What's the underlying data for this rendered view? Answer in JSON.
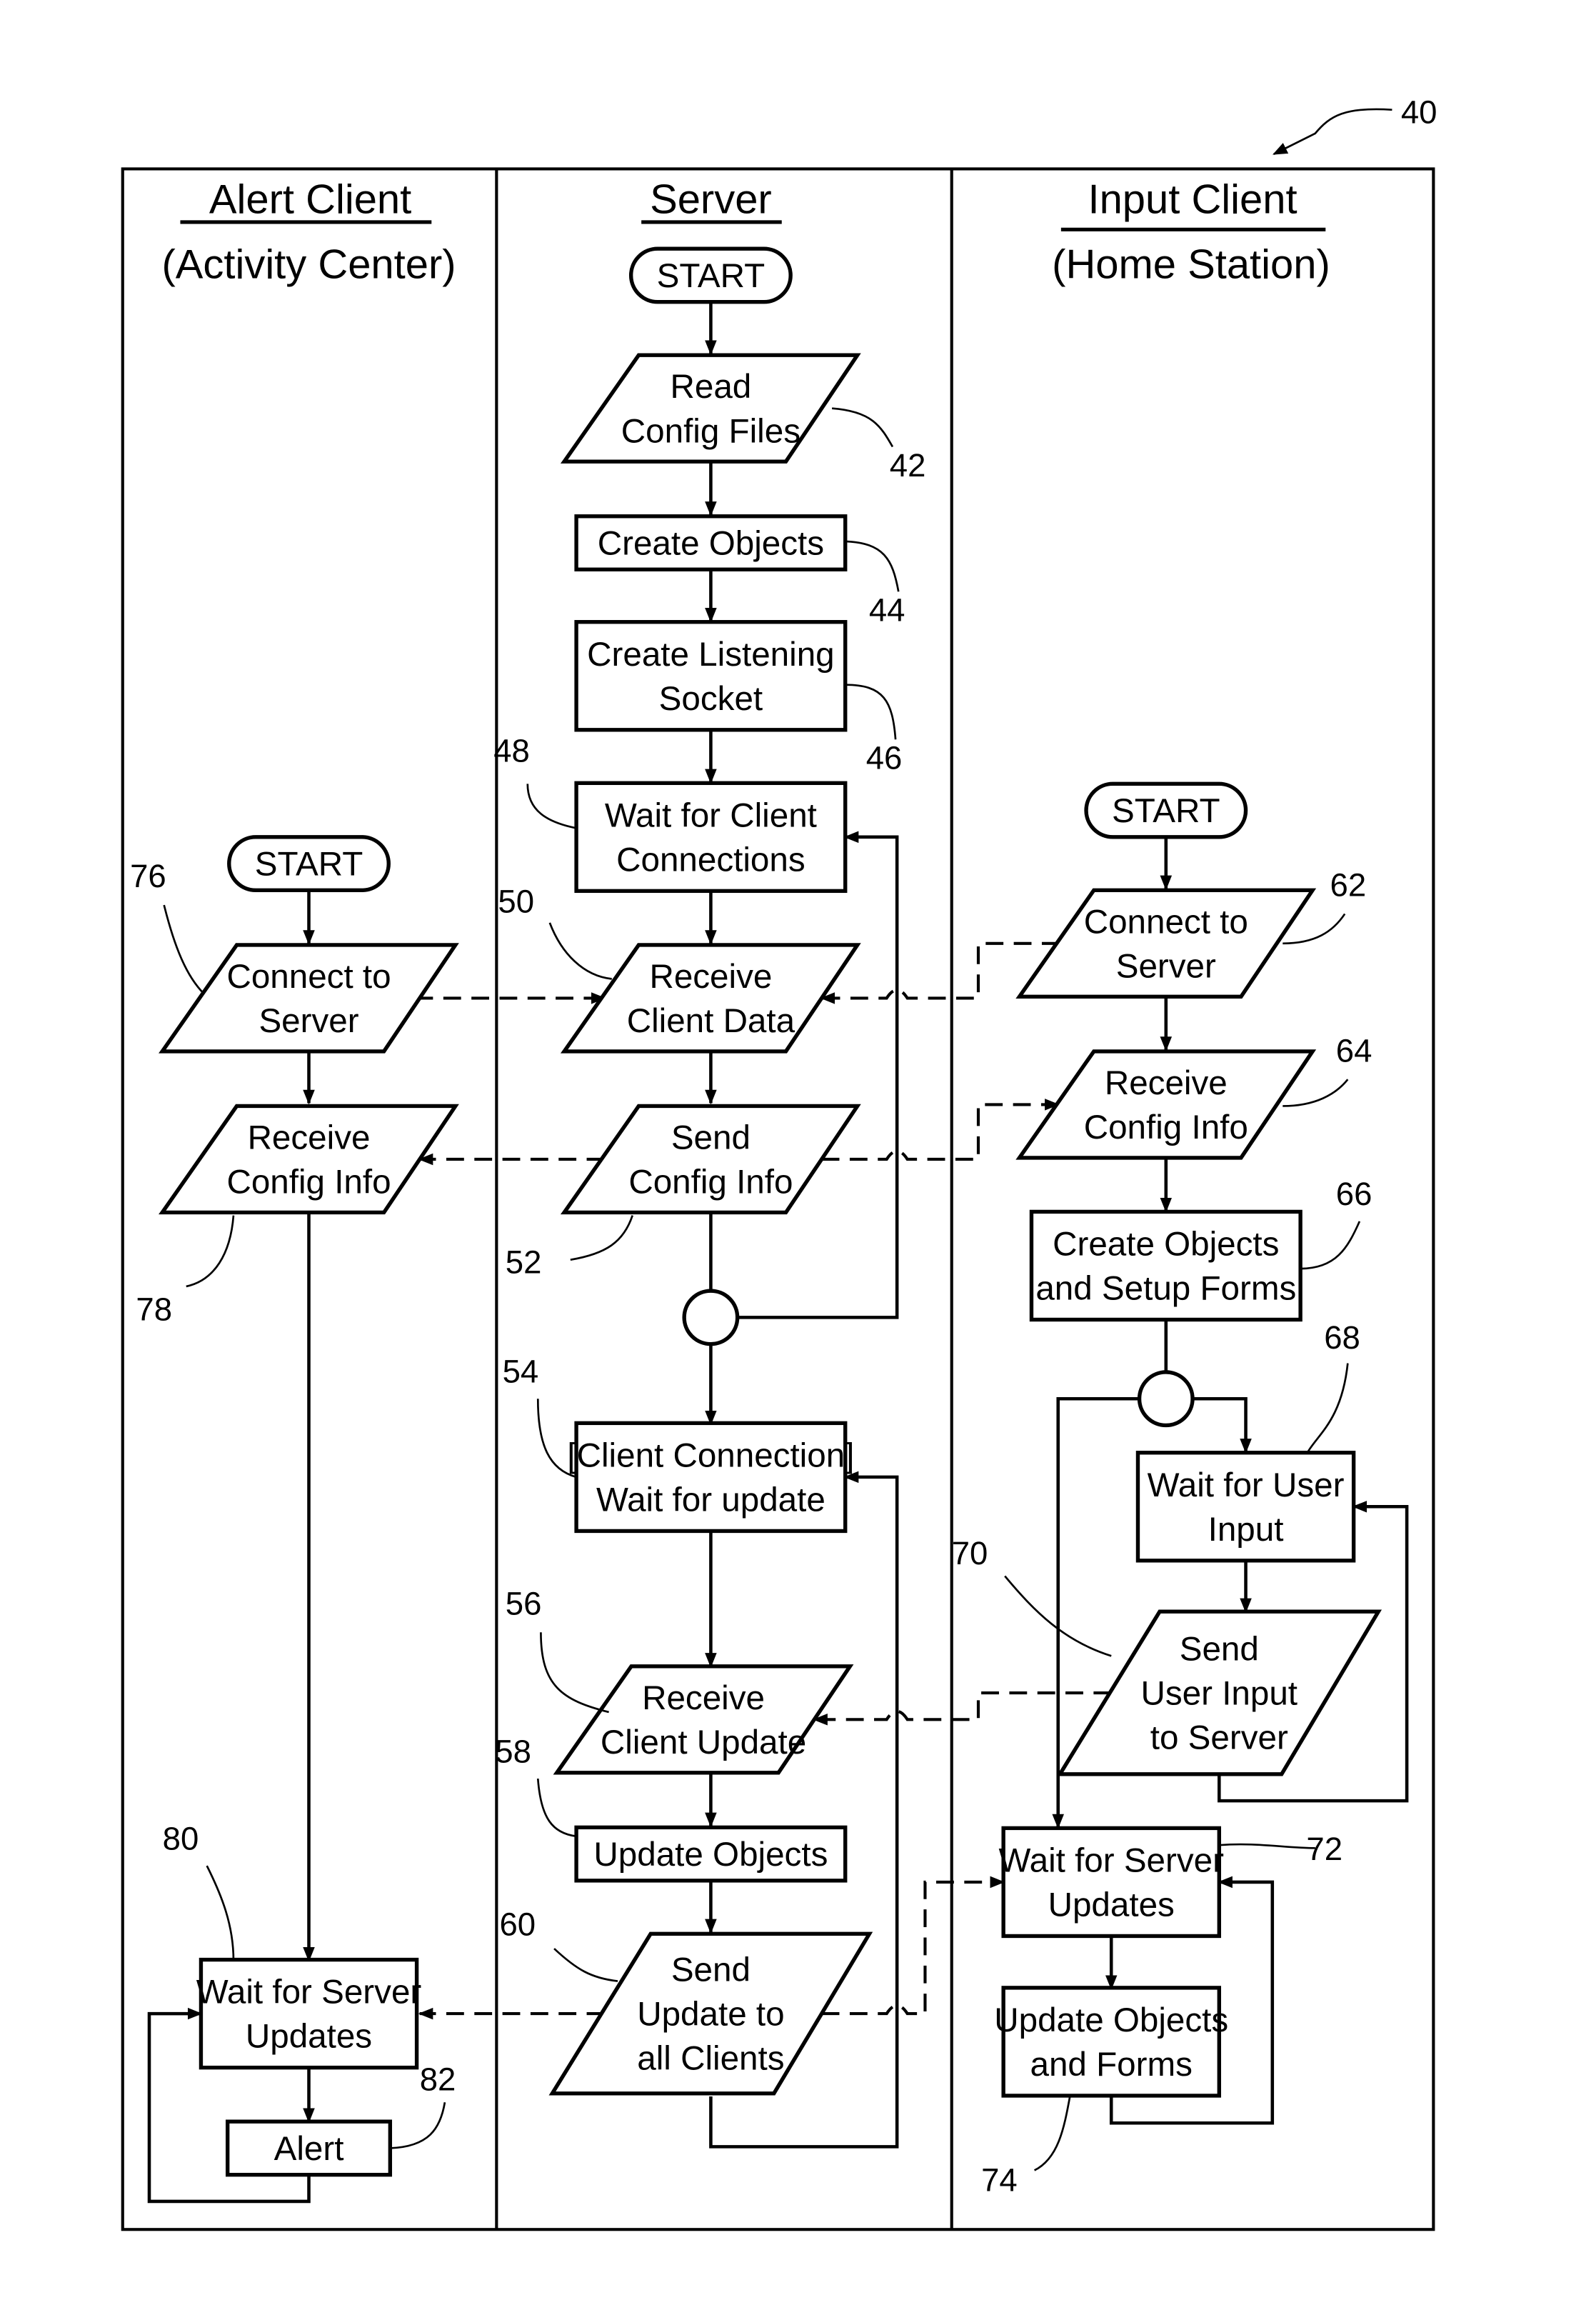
{
  "figure_ref": "40",
  "lanes": [
    {
      "title": "Alert Client",
      "subtitle": "(Activity Center)"
    },
    {
      "title": "Server",
      "subtitle": ""
    },
    {
      "title": "Input Client",
      "subtitle": "(Home Station)"
    }
  ],
  "nodes": {
    "server_start": {
      "lines": [
        "START"
      ]
    },
    "read_config": {
      "lines": [
        "Read",
        "Config Files"
      ],
      "ref": "42"
    },
    "create_objects": {
      "lines": [
        "Create Objects"
      ],
      "ref": "44"
    },
    "create_socket": {
      "lines": [
        "Create Listening",
        "Socket"
      ],
      "ref": "46"
    },
    "wait_client_conn": {
      "lines": [
        "Wait for Client",
        "Connections"
      ],
      "ref": "48"
    },
    "receive_client_data": {
      "lines": [
        "Receive",
        "Client Data"
      ],
      "ref": "50"
    },
    "send_config": {
      "lines": [
        "Send",
        "Config Info"
      ],
      "ref": "52"
    },
    "wait_update": {
      "lines": [
        "[Client Connection]",
        "Wait for update"
      ],
      "ref": "54"
    },
    "receive_client_update": {
      "lines": [
        "Receive",
        "Client Update"
      ],
      "ref": "56"
    },
    "update_objects": {
      "lines": [
        "Update Objects"
      ],
      "ref": "58"
    },
    "send_update": {
      "lines": [
        "Send",
        "Update to",
        "all Clients"
      ],
      "ref": "60"
    },
    "input_start": {
      "lines": [
        "START"
      ]
    },
    "input_connect": {
      "lines": [
        "Connect to",
        "Server"
      ],
      "ref": "62"
    },
    "input_receive_config": {
      "lines": [
        "Receive",
        "Config Info"
      ],
      "ref": "64"
    },
    "input_create": {
      "lines": [
        "Create Objects",
        "and Setup Forms"
      ],
      "ref": "66"
    },
    "wait_user_input": {
      "lines": [
        "Wait for User",
        "Input"
      ],
      "ref": "68"
    },
    "send_user_input": {
      "lines": [
        "Send",
        "User Input",
        "to Server"
      ],
      "ref": "70"
    },
    "input_wait_server": {
      "lines": [
        "Wait for Server",
        "Updates"
      ],
      "ref": "72"
    },
    "update_objects_forms": {
      "lines": [
        "Update Objects",
        "and Forms"
      ],
      "ref": "74"
    },
    "alert_start": {
      "lines": [
        "START"
      ]
    },
    "alert_connect": {
      "lines": [
        "Connect to",
        "Server"
      ],
      "ref": "76"
    },
    "alert_receive_config": {
      "lines": [
        "Receive",
        "Config Info"
      ],
      "ref": "78"
    },
    "alert_wait_server": {
      "lines": [
        "Wait for Server",
        "Updates"
      ],
      "ref": "80"
    },
    "alert": {
      "lines": [
        "Alert"
      ],
      "ref": "82"
    }
  }
}
